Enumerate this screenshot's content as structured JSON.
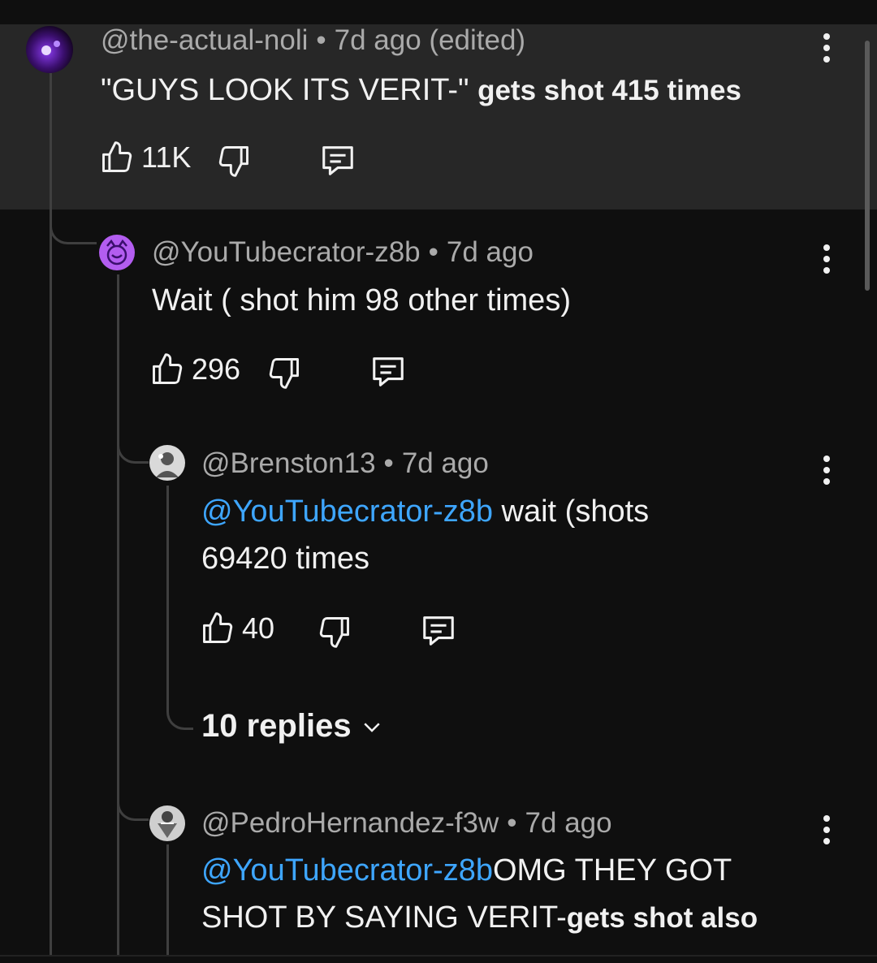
{
  "comments": [
    {
      "author": "@the-actual-noli",
      "time": "7d ago (edited)",
      "text_main": "\"GUYS LOOK ITS VERIT-\"",
      "text_bold": "gets shot 415 times",
      "likes": "11K"
    },
    {
      "author": "@YouTubecrator-z8b",
      "time": "7d ago",
      "text_main": "Wait ( shot him 98 other times)",
      "likes": "296"
    },
    {
      "author": "@Brenston13",
      "time": "7d ago",
      "mention": "@YouTubecrator-z8b",
      "text_line1": "wait (shots",
      "text_line2": "69420 times",
      "likes": "40",
      "replies_label": "10 replies"
    },
    {
      "author": "@PedroHernandez-f3w",
      "time": "7d ago",
      "mention": "@YouTubecrator-z8b",
      "text_line1": "OMG THEY GOT",
      "text_line2": "SHOT BY SAYING VERIT-",
      "text_bold": "gets shot also"
    }
  ],
  "separator": "•",
  "icons": {
    "like": "thumb-up-icon",
    "dislike": "thumb-down-icon",
    "reply": "reply-comment-icon",
    "more": "more-vertical-icon",
    "expand": "chevron-down-icon"
  },
  "colors": {
    "background": "#0f0f0f",
    "highlight": "#272727",
    "mention": "#3ea6ff",
    "meta": "#aaaaaa"
  }
}
